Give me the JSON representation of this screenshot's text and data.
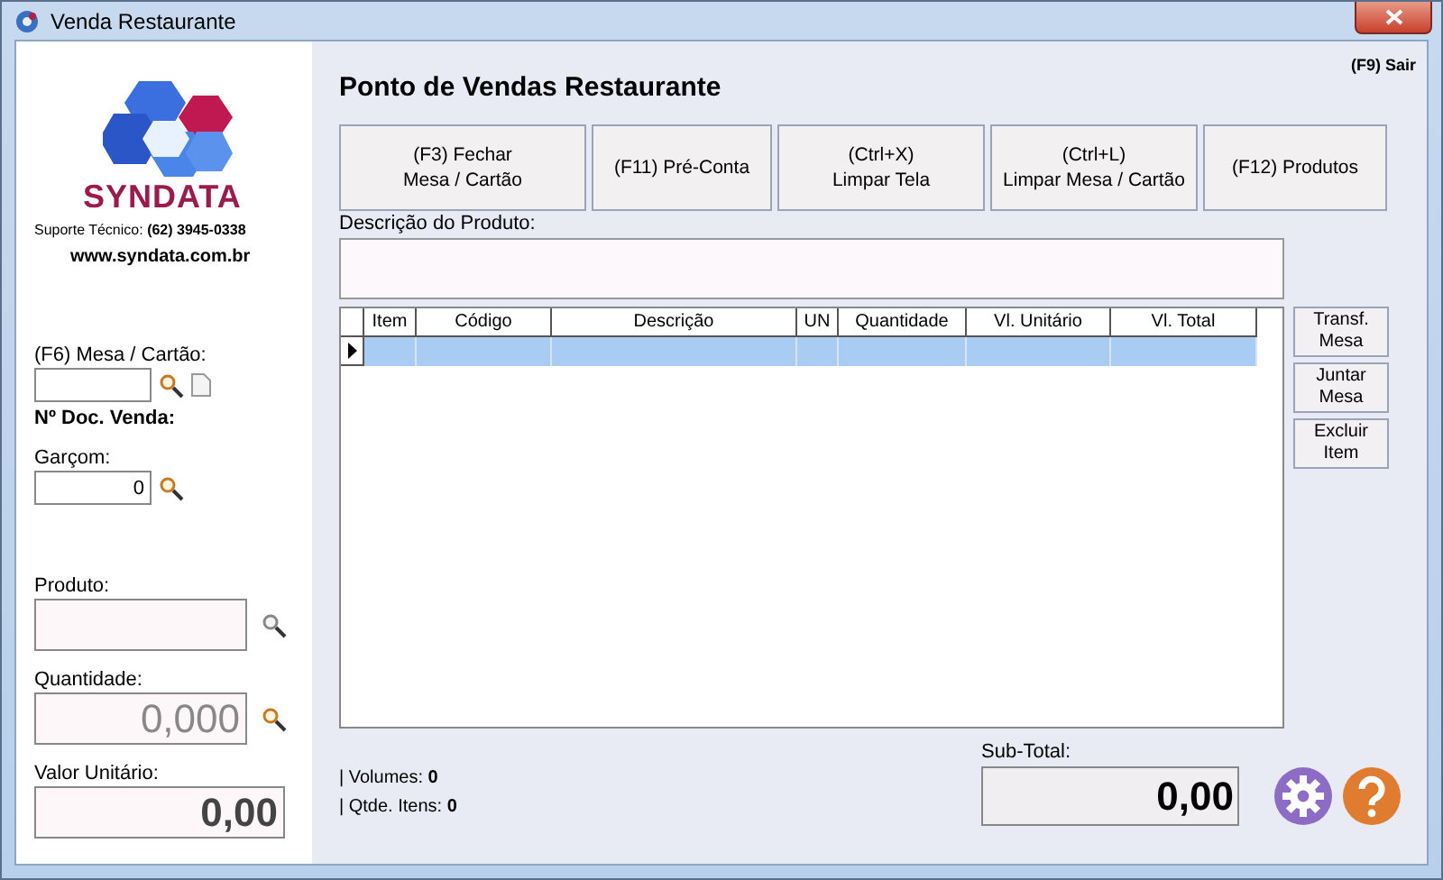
{
  "window": {
    "title": "Venda Restaurante"
  },
  "sidebar": {
    "brand": "SYNDATA",
    "support": "Suporte Técnico: **(62) 3945-0338**",
    "website": "www.syndata.com.br",
    "mesa": {
      "label": "(F6) Mesa / Cartão:"
    },
    "doc_label": "Nº Doc. Venda:",
    "garcom": {
      "label": "Garçom:",
      "value": "0"
    },
    "produto": {
      "label": "Produto:"
    },
    "quantidade": {
      "label": "Quantidade:",
      "placeholder": "0,000"
    },
    "valor_unitario": {
      "label": "Valor Unitário:",
      "value": "0,00"
    }
  },
  "header": {
    "title": "Ponto de Vendas Restaurante",
    "exit": "(F9) Sair"
  },
  "actions": [
    {
      "lines": [
        "(F3) Fechar",
        "Mesa / Cartão"
      ]
    },
    {
      "lines": [
        "(F11) Pré-Conta"
      ]
    },
    {
      "lines": [
        "(Ctrl+X)",
        "Limpar Tela"
      ]
    },
    {
      "lines": [
        "(Ctrl+L)",
        "Limpar Mesa / Cartão"
      ]
    },
    {
      "lines": [
        "(F12) Produtos"
      ]
    }
  ],
  "description": {
    "label": "Descrição do Produto:"
  },
  "table": {
    "columns": [
      "Item",
      "Código",
      "Descrição",
      "UN",
      "Quantidade",
      "Vl. Unitário",
      "Vl. Total"
    ],
    "rows": [
      {
        "selected": true
      }
    ]
  },
  "side_buttons": [
    {
      "lines": [
        "Transf.",
        "Mesa"
      ]
    },
    {
      "lines": [
        "Juntar",
        "Mesa"
      ]
    },
    {
      "lines": [
        "Excluir",
        "Item"
      ]
    }
  ],
  "summary": [
    "| Volumes: **0**",
    "| Qtde. Itens: **0**"
  ],
  "subtotal": {
    "label": "Sub-Total:",
    "value": "0,00"
  }
}
